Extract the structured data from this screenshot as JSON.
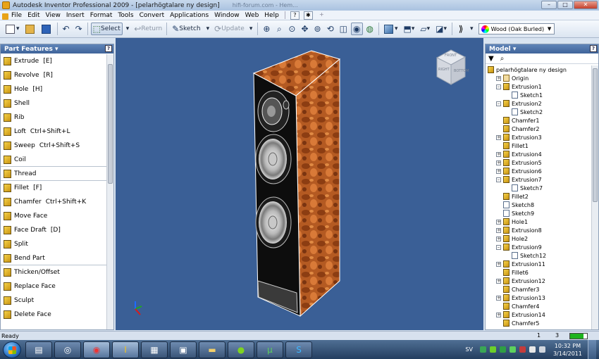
{
  "titlebar": {
    "title": "Autodesk Inventor Professional 2009 - [pelarhögtalare ny design]",
    "background_tab_text": "hifi-forum.com - Hem...",
    "minimize": "–",
    "maximize": "□",
    "close": "✕"
  },
  "menubar": {
    "items": [
      "File",
      "Edit",
      "View",
      "Insert",
      "Format",
      "Tools",
      "Convert",
      "Applications",
      "Window",
      "Web",
      "Help"
    ]
  },
  "toolbar": {
    "select_label": "Select",
    "return_label": "Return",
    "sketch_label": "Sketch",
    "update_label": "Update",
    "material": "Wood (Oak Burled)"
  },
  "left_panel": {
    "header": "Part Features ▾",
    "help": "?",
    "features": [
      {
        "label": "Extrude",
        "shortcut": "[E]"
      },
      {
        "label": "Revolve",
        "shortcut": "[R]"
      },
      {
        "label": "Hole",
        "shortcut": "[H]"
      },
      {
        "label": "Shell",
        "shortcut": ""
      },
      {
        "label": "Rib",
        "shortcut": ""
      },
      {
        "label": "Loft",
        "shortcut": "Ctrl+Shift+L"
      },
      {
        "label": "Sweep",
        "shortcut": "Ctrl+Shift+S"
      },
      {
        "label": "Coil",
        "shortcut": ""
      },
      {
        "label": "Thread",
        "shortcut": ""
      },
      {
        "label": "Fillet",
        "shortcut": "[F]"
      },
      {
        "label": "Chamfer",
        "shortcut": "Ctrl+Shift+K"
      },
      {
        "label": "Move Face",
        "shortcut": ""
      },
      {
        "label": "Face Draft",
        "shortcut": "[D]"
      },
      {
        "label": "Split",
        "shortcut": ""
      },
      {
        "label": "Bend Part",
        "shortcut": ""
      },
      {
        "label": "Thicken/Offset",
        "shortcut": ""
      },
      {
        "label": "Replace Face",
        "shortcut": ""
      },
      {
        "label": "Sculpt",
        "shortcut": ""
      },
      {
        "label": "Delete Face",
        "shortcut": ""
      }
    ]
  },
  "viewcube": {
    "front": "FRONT",
    "right": "RIGHT",
    "bottom": "BOTTOM"
  },
  "right_panel": {
    "header": "Model ▾",
    "help": "?",
    "filter_icon": "▼",
    "find_icon": "⌕",
    "tree": [
      {
        "label": "pelarhögtalare ny design",
        "icon": "part",
        "expander": "",
        "level": 0
      },
      {
        "label": "Origin",
        "icon": "origin",
        "expander": "+",
        "level": 1
      },
      {
        "label": "Extrusion1",
        "icon": "feature",
        "expander": "–",
        "level": 1
      },
      {
        "label": "Sketch1",
        "icon": "sketch",
        "expander": "",
        "level": 2
      },
      {
        "label": "Extrusion2",
        "icon": "feature",
        "expander": "–",
        "level": 1
      },
      {
        "label": "Sketch2",
        "icon": "sketch",
        "expander": "",
        "level": 2
      },
      {
        "label": "Chamfer1",
        "icon": "feature",
        "expander": "",
        "level": 1
      },
      {
        "label": "Chamfer2",
        "icon": "feature",
        "expander": "",
        "level": 1
      },
      {
        "label": "Extrusion3",
        "icon": "feature",
        "expander": "+",
        "level": 1
      },
      {
        "label": "Fillet1",
        "icon": "feature",
        "expander": "",
        "level": 1
      },
      {
        "label": "Extrusion4",
        "icon": "feature",
        "expander": "+",
        "level": 1
      },
      {
        "label": "Extrusion5",
        "icon": "feature",
        "expander": "+",
        "level": 1
      },
      {
        "label": "Extrusion6",
        "icon": "feature",
        "expander": "+",
        "level": 1
      },
      {
        "label": "Extrusion7",
        "icon": "feature",
        "expander": "–",
        "level": 1
      },
      {
        "label": "Sketch7",
        "icon": "sketch",
        "expander": "",
        "level": 2
      },
      {
        "label": "Fillet2",
        "icon": "feature",
        "expander": "",
        "level": 1
      },
      {
        "label": "Sketch8",
        "icon": "sketch",
        "expander": "",
        "level": 1
      },
      {
        "label": "Sketch9",
        "icon": "sketch",
        "expander": "",
        "level": 1
      },
      {
        "label": "Hole1",
        "icon": "feature",
        "expander": "+",
        "level": 1
      },
      {
        "label": "Extrusion8",
        "icon": "feature",
        "expander": "+",
        "level": 1
      },
      {
        "label": "Hole2",
        "icon": "feature",
        "expander": "+",
        "level": 1
      },
      {
        "label": "Extrusion9",
        "icon": "feature",
        "expander": "–",
        "level": 1
      },
      {
        "label": "Sketch12",
        "icon": "sketch",
        "expander": "",
        "level": 2
      },
      {
        "label": "Extrusion11",
        "icon": "feature",
        "expander": "+",
        "level": 1
      },
      {
        "label": "Fillet6",
        "icon": "feature",
        "expander": "",
        "level": 1
      },
      {
        "label": "Extrusion12",
        "icon": "feature",
        "expander": "+",
        "level": 1
      },
      {
        "label": "Chamfer3",
        "icon": "feature",
        "expander": "",
        "level": 1
      },
      {
        "label": "Extrusion13",
        "icon": "feature",
        "expander": "+",
        "level": 1
      },
      {
        "label": "Chamfer4",
        "icon": "feature",
        "expander": "",
        "level": 1
      },
      {
        "label": "Extrusion14",
        "icon": "feature",
        "expander": "+",
        "level": 1
      },
      {
        "label": "Chamfer5",
        "icon": "feature",
        "expander": "",
        "level": 1
      }
    ]
  },
  "statusbar": {
    "status": "Ready",
    "count_a": "1",
    "count_b": "3",
    "memory_fraction": 0.8
  },
  "taskbar": {
    "language": "SV",
    "time": "10:32 PM",
    "date": "3/14/2011",
    "apps": [
      "explorer-window",
      "media",
      "chrome",
      "inventor",
      "calculator",
      "network",
      "folder",
      "spotify",
      "utorrent",
      "skype"
    ]
  },
  "colors": {
    "viewport_bg": "#3a5f96",
    "wood": "#b25a22",
    "cabinet_front": "#0d0d0d"
  }
}
